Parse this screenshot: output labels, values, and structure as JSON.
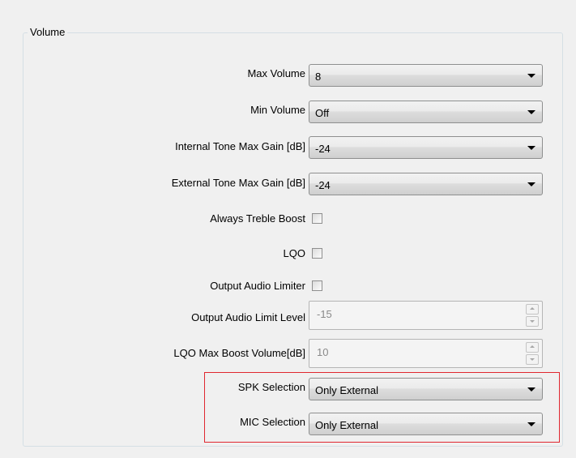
{
  "group": {
    "title": "Volume"
  },
  "fields": {
    "max_volume": {
      "label": "Max Volume",
      "value": "8"
    },
    "min_volume": {
      "label": "Min Volume",
      "value": "Off"
    },
    "internal_tone": {
      "label": "Internal Tone Max Gain [dB]",
      "value": "-24"
    },
    "external_tone": {
      "label": "External Tone Max Gain [dB]",
      "value": "-24"
    },
    "treble_boost": {
      "label": "Always Treble Boost",
      "checked": false
    },
    "lqo": {
      "label": "LQO",
      "checked": false
    },
    "output_limiter": {
      "label": "Output Audio Limiter",
      "checked": false
    },
    "output_limit_level": {
      "label": "Output Audio Limit Level",
      "value": "-15"
    },
    "lqo_max_boost": {
      "label": "LQO Max Boost Volume[dB]",
      "value": "10"
    },
    "spk_selection": {
      "label": "SPK Selection",
      "value": "Only External"
    },
    "mic_selection": {
      "label": "MIC Selection",
      "value": "Only External"
    }
  },
  "colors": {
    "highlight_border": "#e0272f"
  }
}
